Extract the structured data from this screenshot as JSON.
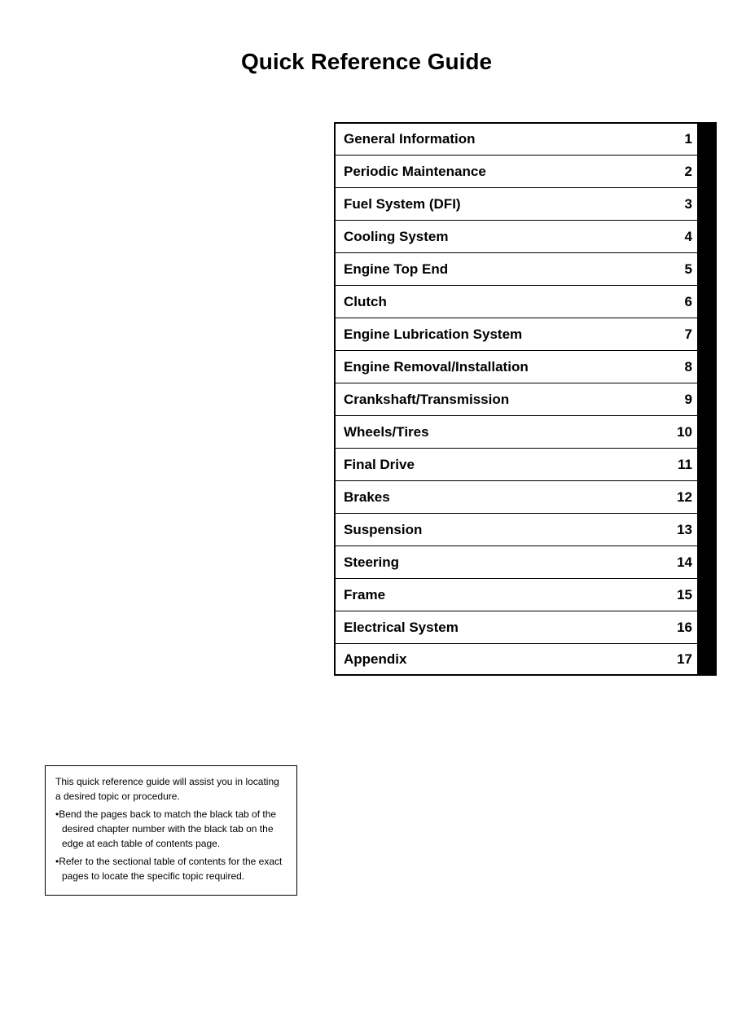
{
  "page": {
    "title": "Quick Reference Guide"
  },
  "toc": {
    "items": [
      {
        "label": "General Information",
        "number": "1"
      },
      {
        "label": "Periodic Maintenance",
        "number": "2"
      },
      {
        "label": "Fuel System (DFI)",
        "number": "3"
      },
      {
        "label": "Cooling System",
        "number": "4"
      },
      {
        "label": "Engine Top End",
        "number": "5"
      },
      {
        "label": "Clutch",
        "number": "6"
      },
      {
        "label": "Engine Lubrication System",
        "number": "7"
      },
      {
        "label": "Engine Removal/Installation",
        "number": "8"
      },
      {
        "label": "Crankshaft/Transmission",
        "number": "9"
      },
      {
        "label": "Wheels/Tires",
        "number": "10"
      },
      {
        "label": "Final Drive",
        "number": "11"
      },
      {
        "label": "Brakes",
        "number": "12"
      },
      {
        "label": "Suspension",
        "number": "13"
      },
      {
        "label": "Steering",
        "number": "14"
      },
      {
        "label": "Frame",
        "number": "15"
      },
      {
        "label": "Electrical System",
        "number": "16"
      },
      {
        "label": "Appendix",
        "number": "17"
      }
    ]
  },
  "info_box": {
    "intro": "This quick reference guide will assist you in locating a desired topic or procedure.",
    "bullet1": "Bend the pages back to match the black tab of the desired chapter number with the black tab on the edge at each table of contents page.",
    "bullet2": "Refer to the sectional table of contents for the exact pages to locate the specific topic required."
  }
}
